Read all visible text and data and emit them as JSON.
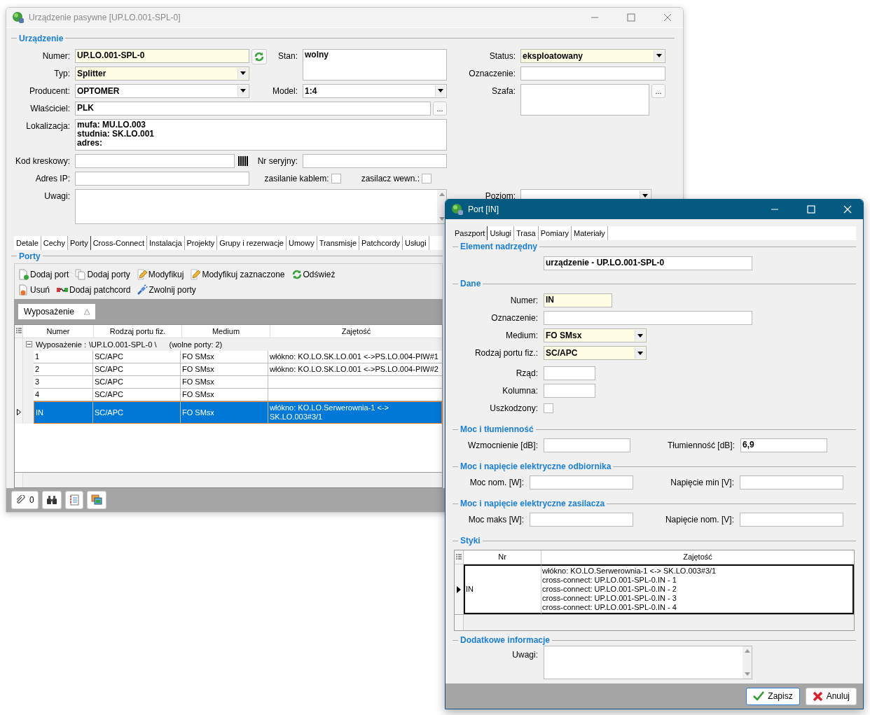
{
  "device_window": {
    "title": "Urządzenie pasywne [UP.LO.001-SPL-0]",
    "section": "Urządzenie",
    "numer": {
      "label": "Numer:",
      "value": "UP.LO.001-SPL-0",
      "required": true
    },
    "stan": {
      "label": "Stan:",
      "value": "wolny"
    },
    "typ": {
      "label": "Typ:",
      "value": "Splitter",
      "required": true
    },
    "producent": {
      "label": "Producent:",
      "value": "OPTOMER",
      "required": false
    },
    "model": {
      "label": "Model:",
      "value": "1:4",
      "required": false
    },
    "wlasciciel": {
      "label": "Właściciel:",
      "value": "PLK",
      "browse": "..."
    },
    "lokalizacja": {
      "label": "Lokalizacja:",
      "lines": [
        "mufa: MU.LO.003",
        "studnia: SK.LO.001",
        "adres:"
      ]
    },
    "kod": {
      "label": "Kod kreskowy:"
    },
    "nr_seryjny": {
      "label": "Nr seryjny:"
    },
    "adres_ip": {
      "label": "Adres IP:"
    },
    "zasilanie_kablem": {
      "label": "zasilanie kablem:",
      "checked": false
    },
    "zasilacz": {
      "label": "zasilacz wewn.:",
      "checked": false
    },
    "uwagi": {
      "label": "Uwagi:"
    },
    "status": {
      "label": "Status:",
      "value": "eksploatowany",
      "required": true
    },
    "oznaczenie": {
      "label": "Oznaczenie:"
    },
    "szafa": {
      "label": "Szafa:",
      "browse": "..."
    },
    "poziom": {
      "label": "Poziom:"
    },
    "tabs": [
      {
        "label": "Detale",
        "selected": false
      },
      {
        "label": "Cechy",
        "selected": false
      },
      {
        "label": "Porty",
        "selected": true
      },
      {
        "label": "Cross-Connect",
        "selected": false
      },
      {
        "label": "Instalacja",
        "selected": false
      },
      {
        "label": "Projekty",
        "selected": false
      },
      {
        "label": "Grupy i rezerwacje",
        "selected": false
      },
      {
        "label": "Umowy",
        "selected": false
      },
      {
        "label": "Transmisje",
        "selected": false
      },
      {
        "label": "Patchcordy",
        "selected": false
      },
      {
        "label": "Usługi",
        "selected": false
      }
    ],
    "ports": {
      "section": "Porty",
      "toolbar": [
        [
          {
            "kind": "add",
            "label": "Dodaj port"
          },
          {
            "kind": "copy",
            "label": "Dodaj porty"
          },
          {
            "kind": "edit",
            "label": "Modyfikuj"
          },
          {
            "kind": "edit",
            "label": "Modyfikuj zaznaczone"
          },
          {
            "kind": "refresh",
            "label": "Odśwież"
          }
        ],
        [
          {
            "kind": "remove",
            "label": "Usuń"
          },
          {
            "kind": "patchcord",
            "label": "Dodaj patchcord"
          },
          {
            "kind": "plug",
            "label": "Zwolnij porty"
          }
        ]
      ],
      "group_chip": "Wyposażenie",
      "group_sort": "△",
      "columns": [
        "Numer",
        "Rodzaj portu fiz.",
        "Medium",
        "Zajętość"
      ],
      "group_row": {
        "label": "Wyposażenie :",
        "path": "\\UP.LO.001-SPL-0 \\",
        "free": "(wolne porty: 2)",
        "expanded": true
      },
      "rows": [
        {
          "cells": [
            "1",
            "SC/APC",
            "FO SMsx",
            "włókno: KO.LO.SK.LO.001 <->PS.LO.004-PIW#1"
          ],
          "selected": false
        },
        {
          "cells": [
            "2",
            "SC/APC",
            "FO SMsx",
            "włókno: KO.LO.SK.LO.001 <->PS.LO.004-PIW#2"
          ],
          "selected": false
        },
        {
          "cells": [
            "3",
            "SC/APC",
            "FO SMsx",
            ""
          ],
          "selected": false
        },
        {
          "cells": [
            "4",
            "SC/APC",
            "FO SMsx",
            ""
          ],
          "selected": false
        },
        {
          "cells": [
            "IN",
            "SC/APC",
            "FO SMsx",
            "włókno: KO.LO.Serwerownia-1 <-> SK.LO.003#3/1"
          ],
          "selected": true
        }
      ]
    },
    "bottom_buttons": [
      {
        "kind": "attachment",
        "label": "0"
      },
      {
        "kind": "binoculars"
      },
      {
        "kind": "notes"
      },
      {
        "kind": "windows"
      }
    ]
  },
  "port_window": {
    "title": "Port [IN]",
    "tabs": [
      {
        "label": "Paszport",
        "selected": true
      },
      {
        "label": "Usługi",
        "selected": false
      },
      {
        "label": "Trasa",
        "selected": false
      },
      {
        "label": "Pomiary",
        "selected": false
      },
      {
        "label": "Materiały",
        "selected": false
      }
    ],
    "parent": {
      "section": "Element nadrzędny",
      "value": "urządzenie - UP.LO.001-SPL-0"
    },
    "dane": {
      "section": "Dane",
      "numer": {
        "label": "Numer:",
        "value": "IN",
        "required": true
      },
      "oznaczenie": {
        "label": "Oznaczenie:"
      },
      "medium": {
        "label": "Medium:",
        "value": "FO SMsx",
        "required": true
      },
      "rodzaj": {
        "label": "Rodzaj portu fiz.:",
        "value": "SC/APC",
        "required": true
      },
      "rzad": {
        "label": "Rząd:"
      },
      "kolumna": {
        "label": "Kolumna:"
      },
      "uszkodzony": {
        "label": "Uszkodzony:",
        "checked": false
      }
    },
    "moc": {
      "section": "Moc i tłumienność",
      "wzmocnienie": {
        "label": "Wzmocnienie [dB]:"
      },
      "tlumiennosc": {
        "label": "Tłumienność [dB]:",
        "value": "6,9"
      }
    },
    "odbiornik": {
      "section": "Moc i napięcie elektryczne odbiornika",
      "left": {
        "label": "Moc nom. [W]:"
      },
      "right": {
        "label": "Napięcie min [V]:"
      }
    },
    "zasilacz": {
      "section": "Moc i napięcie elektryczne zasilacza",
      "left": {
        "label": "Moc maks [W]:"
      },
      "right": {
        "label": "Napięcie nom. [V]:"
      }
    },
    "styki": {
      "section": "Styki",
      "columns": [
        "Nr",
        "Zajętość"
      ],
      "rows": [
        {
          "nr": "IN",
          "lines": [
            "włókno: KO.LO.Serwerownia-1 <-> SK.LO.003#3/1",
            "cross-connect: UP.LO.001-SPL-0.IN - 1",
            "cross-connect: UP.LO.001-SPL-0.IN - 2",
            "cross-connect: UP.LO.001-SPL-0.IN - 3",
            "cross-connect: UP.LO.001-SPL-0.IN - 4"
          ],
          "selected": true
        }
      ]
    },
    "dodatkowe": {
      "section": "Dodatkowe informacje",
      "uwagi": {
        "label": "Uwagi:"
      }
    },
    "buttons": [
      {
        "kind": "save",
        "label": "Zapisz",
        "default": true
      },
      {
        "kind": "cancel",
        "label": "Anuluj",
        "default": false
      }
    ]
  }
}
